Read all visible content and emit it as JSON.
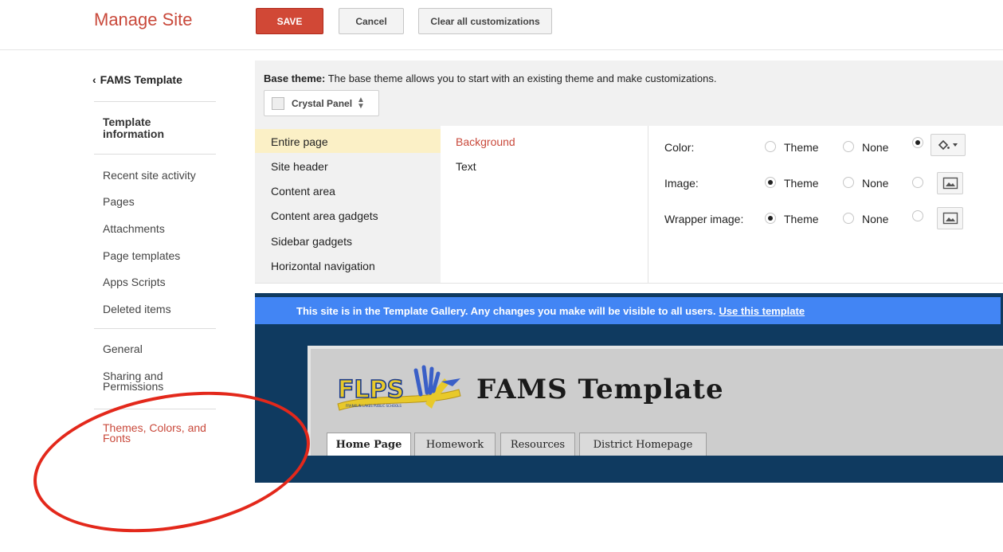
{
  "header": {
    "title": "Manage Site",
    "save_label": "SAVE",
    "cancel_label": "Cancel",
    "clear_label": "Clear all customizations"
  },
  "sidebar": {
    "back_label": "FAMS Template",
    "template_info": "Template information",
    "items": [
      "Recent site activity",
      "Pages",
      "Attachments",
      "Page templates",
      "Apps Scripts",
      "Deleted items"
    ],
    "general": "General",
    "sharing": "Sharing and Permissions",
    "themes": "Themes, Colors, and Fonts"
  },
  "theme": {
    "base_label": "Base theme:",
    "base_desc": "The base theme allows you to start with an existing theme and make customizations.",
    "selected": "Crystal Panel"
  },
  "sections": [
    "Entire page",
    "Site header",
    "Content area",
    "Content area gadgets",
    "Sidebar gadgets",
    "Horizontal navigation"
  ],
  "subsections": [
    "Background",
    "Text"
  ],
  "properties": {
    "color_label": "Color:",
    "image_label": "Image:",
    "wrapper_label": "Wrapper image:",
    "theme_option": "Theme",
    "none_option": "None",
    "selected": {
      "color": "custom",
      "image": "theme",
      "wrapper": "theme"
    }
  },
  "preview": {
    "banner_text": "This site is in the Template Gallery. Any changes you make will be visible to all users.",
    "banner_link": "Use this template",
    "site_title": "FAMS Template",
    "logo_text": "FLPS",
    "logo_subtext": "FRANKLIN LAKES PUBLIC SCHOOLS",
    "tabs": [
      "Home Page",
      "Homework",
      "Resources",
      "District Homepage"
    ]
  },
  "colors": {
    "accent_red": "#c9493b",
    "save_red": "#d14836",
    "banner_blue": "#4285f4",
    "preview_navy": "#0f3a60",
    "annotation_red": "#e3281b"
  }
}
